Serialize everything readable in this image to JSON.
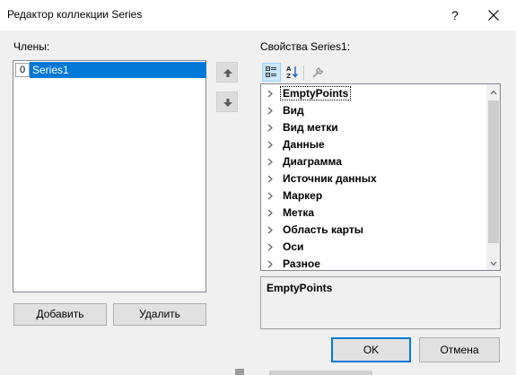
{
  "window": {
    "title": "Редактор коллекции Series",
    "help_label": "?",
    "close_icon": "close-icon"
  },
  "members": {
    "label": "Члены:",
    "items": [
      {
        "index": "0",
        "name": "Series1",
        "selected": true
      }
    ],
    "move_up_icon": "arrow-up-icon",
    "move_down_icon": "arrow-down-icon"
  },
  "buttons": {
    "add": "Добавить",
    "remove": "Удалить",
    "ok": "OK",
    "cancel": "Отмена"
  },
  "properties": {
    "label": "Свойства Series1:",
    "toolbar": {
      "categorized_icon": "categorized-icon",
      "alphabetical_icon": "alphabetical-sort-icon",
      "property_pages_icon": "wrench-icon"
    },
    "categories": [
      "EmptyPoints",
      "Вид",
      "Вид метки",
      "Данные",
      "Диаграмма",
      "Источник данных",
      "Маркер",
      "Метка",
      "Область карты",
      "Оси",
      "Разное"
    ],
    "description_title": "EmptyPoints"
  },
  "colors": {
    "selection": "#0078d7",
    "dialog_bg": "#f0f0f0",
    "default_button_border": "#0078d7"
  }
}
